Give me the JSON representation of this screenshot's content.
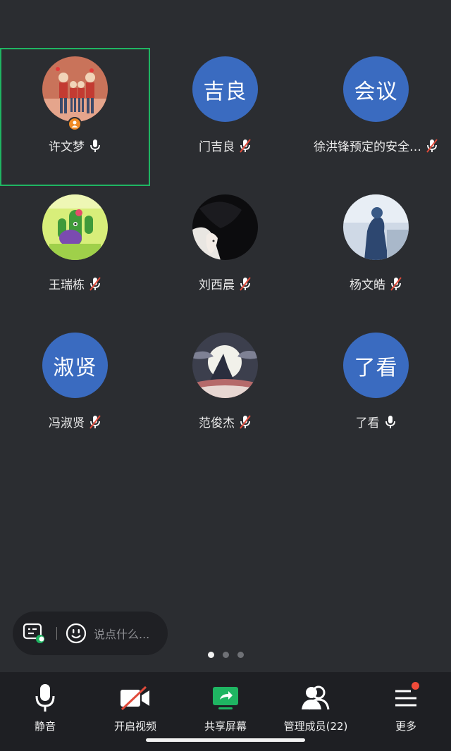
{
  "participants": [
    {
      "name": "许文梦",
      "avatar_text": "",
      "mic": "on",
      "host": true,
      "active": true
    },
    {
      "name": "门吉良",
      "avatar_text": "吉良",
      "mic": "muted"
    },
    {
      "name": "徐洪锋预定的安全…",
      "avatar_text": "会议",
      "mic": "muted"
    },
    {
      "name": "王瑞栋",
      "avatar_text": "",
      "mic": "muted"
    },
    {
      "name": "刘西晨",
      "avatar_text": "",
      "mic": "muted"
    },
    {
      "name": "杨文皓",
      "avatar_text": "",
      "mic": "muted"
    },
    {
      "name": "冯淑贤",
      "avatar_text": "淑贤",
      "mic": "muted"
    },
    {
      "name": "范俊杰",
      "avatar_text": "",
      "mic": "muted"
    },
    {
      "name": "了看",
      "avatar_text": "了看",
      "mic": "on"
    }
  ],
  "chat": {
    "placeholder": "说点什么..."
  },
  "pager": {
    "pages": 3,
    "current": 1
  },
  "toolbar": {
    "mute_label": "静音",
    "video_label": "开启视频",
    "share_label": "共享屏幕",
    "members_label": "管理成员(22)",
    "more_label": "更多"
  },
  "colors": {
    "background": "#2b2d31",
    "toolbar": "#1e1f23",
    "avatar_blue": "#3a6bc0",
    "active_border": "#1fb562",
    "share_green": "#1fb562",
    "host_badge": "#f08a24",
    "notify_red": "#f04b3a"
  }
}
